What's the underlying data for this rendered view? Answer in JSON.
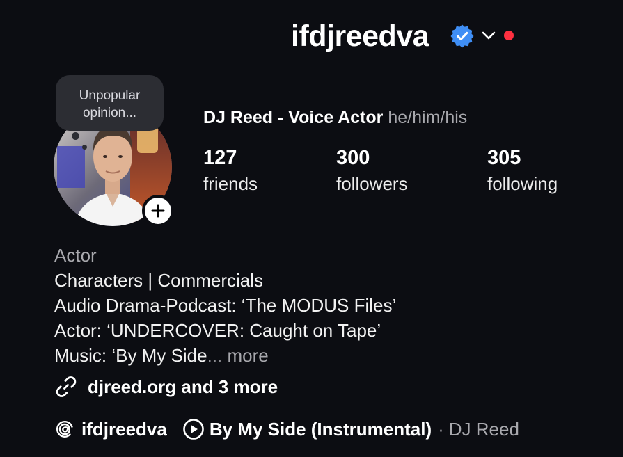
{
  "header": {
    "username": "ifdjreedva",
    "verified_color": "#3f8ef5",
    "notification_dot_color": "#ff3040",
    "icons": [
      "verified-badge-icon",
      "chevron-down-icon"
    ]
  },
  "note": {
    "text": "Unpopular opinion..."
  },
  "profile": {
    "display_name": "DJ Reed - Voice Actor",
    "pronouns": "he/him/his"
  },
  "stats": [
    {
      "count": "127",
      "label": "friends"
    },
    {
      "count": "300",
      "label": "followers"
    },
    {
      "count": "305",
      "label": "following"
    }
  ],
  "bio": {
    "category": "Actor",
    "lines": [
      "Characters | Commercials",
      "Audio Drama-Podcast: ‘The MODUS Files’",
      "Actor: ‘UNDERCOVER: Caught on Tape’",
      "Music: ‘By My Side"
    ],
    "ellipsis": "...",
    "more_label": "more"
  },
  "links": {
    "text": "djreed.org and 3 more",
    "icon": "link-icon"
  },
  "threads": {
    "handle": "ifdjreedva",
    "icon": "threads-icon"
  },
  "music": {
    "title": "By My Side (Instrumental)",
    "separator": "·",
    "artist": "DJ Reed",
    "icon": "play-circle-icon"
  }
}
